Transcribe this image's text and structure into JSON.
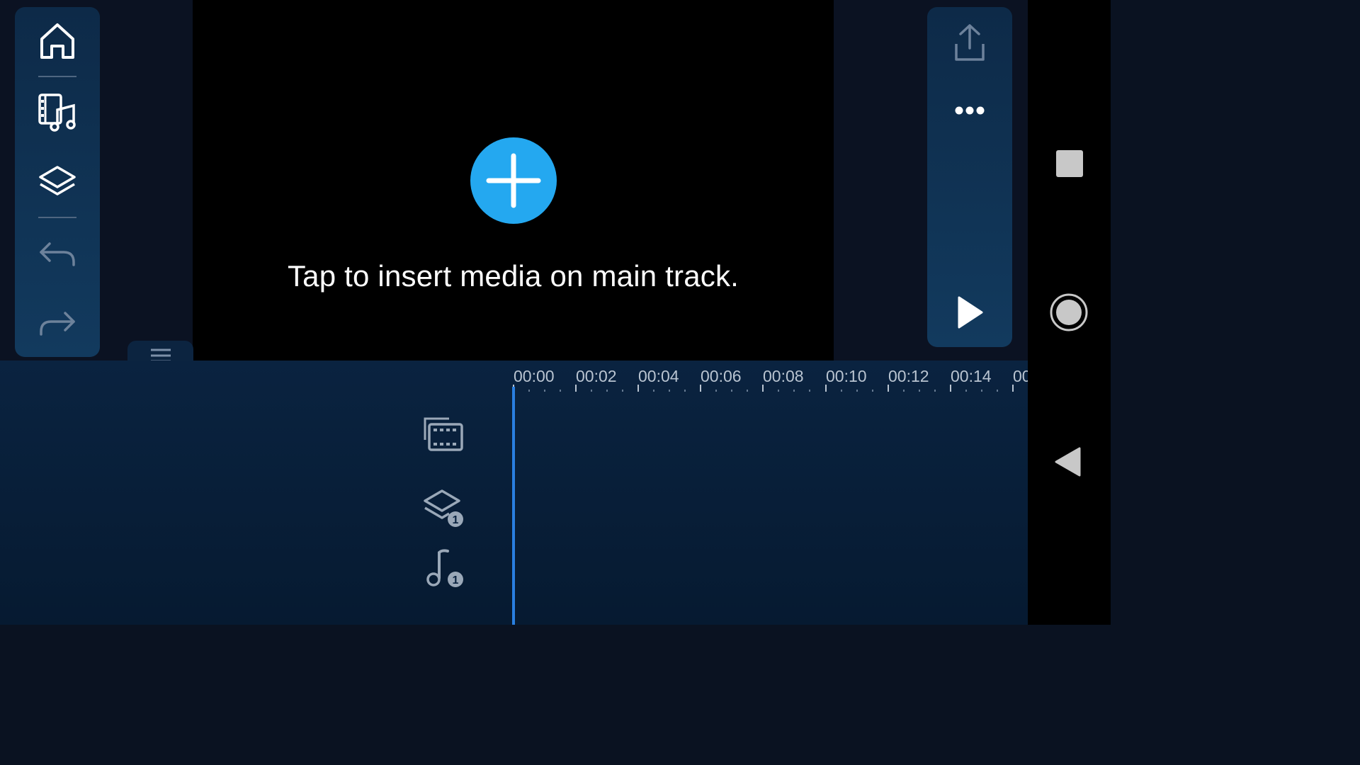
{
  "preview": {
    "hint": "Tap to insert media on main track.",
    "accent_color": "#24a8f0"
  },
  "left_toolbar": {
    "items": [
      {
        "icon": "home-icon"
      },
      {
        "icon": "media-music-icon"
      },
      {
        "icon": "layers-icon"
      },
      {
        "icon": "undo-icon"
      },
      {
        "icon": "redo-icon"
      }
    ]
  },
  "right_toolbar": {
    "items": [
      {
        "icon": "share-export-icon"
      },
      {
        "icon": "more-dots-icon"
      },
      {
        "icon": "play-icon"
      }
    ]
  },
  "timeline": {
    "ticks": [
      "00:00",
      "00:02",
      "00:04",
      "00:06",
      "00:08",
      "00:10",
      "00:12",
      "00:14",
      "00"
    ],
    "tracks": [
      {
        "icon": "video-track-icon"
      },
      {
        "icon": "layer-track-icon",
        "badge": "1"
      },
      {
        "icon": "audio-track-icon",
        "badge": "1"
      }
    ],
    "playhead_color": "#2a7fe0"
  },
  "nav": {
    "items": [
      {
        "icon": "recents-square-icon"
      },
      {
        "icon": "home-circle-icon"
      },
      {
        "icon": "back-triangle-icon"
      }
    ]
  }
}
